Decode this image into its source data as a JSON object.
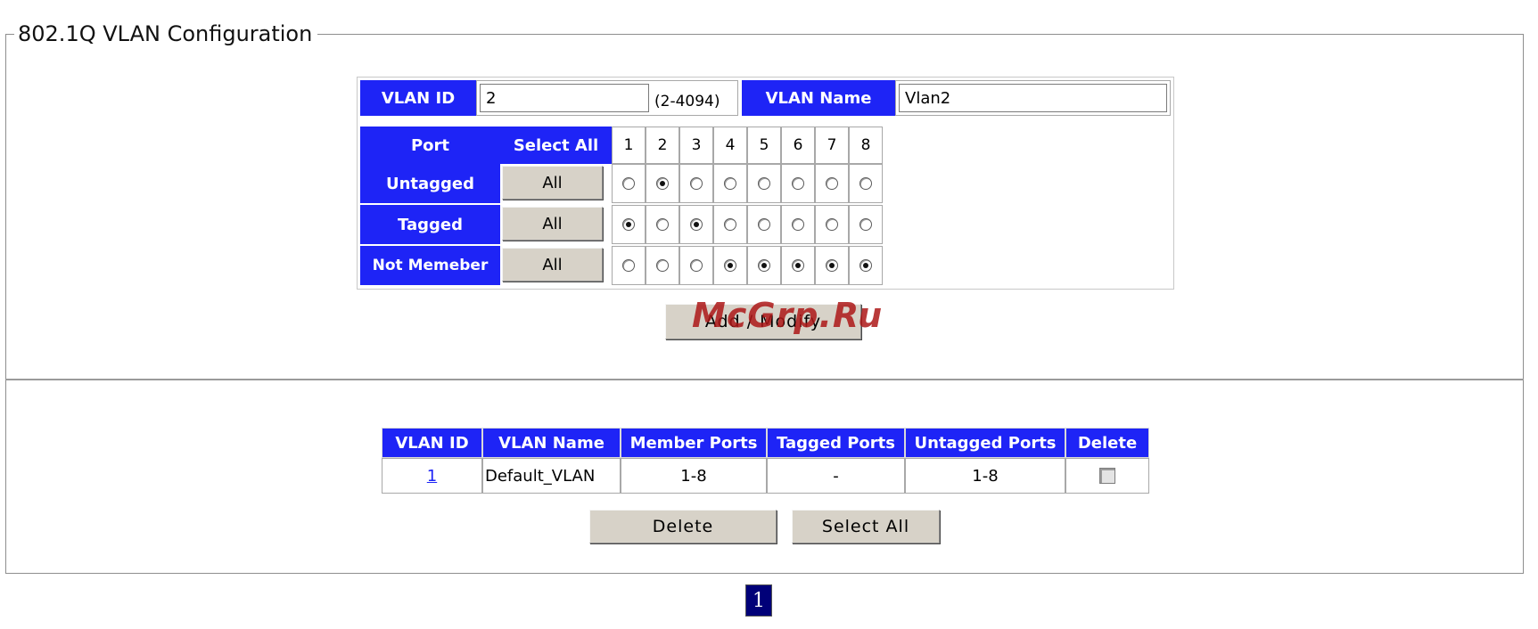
{
  "legend": "802.1Q VLAN Configuration",
  "config": {
    "vlan_id_label": "VLAN ID",
    "vlan_id_value": "2",
    "vlan_id_range": "(2-4094)",
    "vlan_name_label": "VLAN Name",
    "vlan_name_value": "Vlan2",
    "port_label": "Port",
    "select_all_label": "Select All",
    "ports": [
      "1",
      "2",
      "3",
      "4",
      "5",
      "6",
      "7",
      "8"
    ],
    "all_label": "All",
    "rows": [
      {
        "label": "Untagged",
        "selected": [
          false,
          true,
          false,
          false,
          false,
          false,
          false,
          false
        ]
      },
      {
        "label": "Tagged",
        "selected": [
          true,
          false,
          true,
          false,
          false,
          false,
          false,
          false
        ]
      },
      {
        "label": "Not Memeber",
        "selected": [
          false,
          false,
          false,
          true,
          true,
          true,
          true,
          true
        ]
      }
    ],
    "add_modify_label": "Add / Modify"
  },
  "list": {
    "headers": [
      "VLAN ID",
      "VLAN Name",
      "Member Ports",
      "Tagged Ports",
      "Untagged Ports",
      "Delete"
    ],
    "rows": [
      {
        "vlan_id": "1",
        "vlan_name": "Default_VLAN",
        "member_ports": "1-8",
        "tagged_ports": "-",
        "untagged_ports": "1-8",
        "delete_checked": false
      }
    ],
    "delete_label": "Delete",
    "select_all_label": "Select All"
  },
  "page_number": "1",
  "watermark": "McGrp.Ru",
  "colors": {
    "header_blue": "#1e24f6",
    "button_gray": "#d7d2c8",
    "page_badge_navy": "#000078",
    "watermark_red": "#ad1818"
  }
}
